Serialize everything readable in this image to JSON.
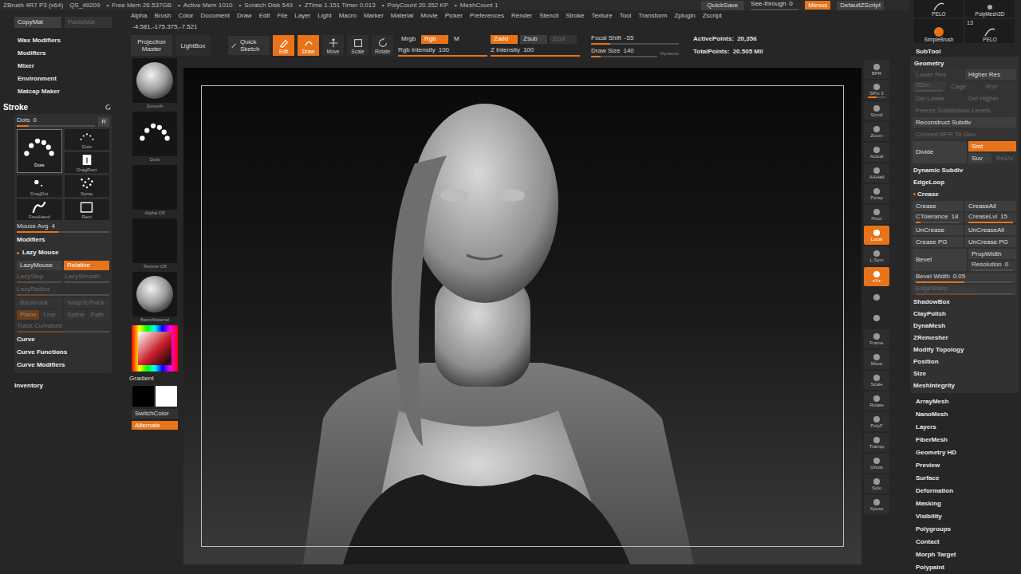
{
  "status_bar": {
    "app": "ZBrush 4R7 P3 (x64)",
    "file": "QS_49209",
    "bullet": "•",
    "stats": [
      "Free Mem 26.537GB",
      "Active Mem 1010",
      "Scratch Disk 549",
      "ZTime 1.151 Timer 0.013",
      "PolyCount 20.352 KP",
      "MeshCount 1"
    ],
    "quicksave": "QuickSave",
    "see_through": {
      "label": "See-through",
      "value": "0",
      "level": 0
    },
    "menus": {
      "label": "Menus",
      "selected": true
    },
    "script": "DefaultZScript"
  },
  "menu": [
    "Alpha",
    "Brush",
    "Color",
    "Document",
    "Draw",
    "Edit",
    "File",
    "Layer",
    "Light",
    "Macro",
    "Marker",
    "Material",
    "Movie",
    "Picker",
    "Preferences",
    "Render",
    "Stencil",
    "Stroke",
    "Texture",
    "Tool",
    "Transform",
    "Zplugin",
    "Zscript"
  ],
  "coords": "-4.581,-175.375,-7.521",
  "toolbar": {
    "large_buttons": [
      {
        "label": "Projection Master",
        "selected": false
      },
      {
        "label": "LightBox",
        "selected": false
      }
    ],
    "quick_sketch": {
      "label": "Quick Sketch",
      "selected": false
    },
    "modes": [
      {
        "label": "Edit",
        "selected": true
      },
      {
        "label": "Draw",
        "selected": true
      },
      {
        "label": "Move",
        "selected": false
      },
      {
        "label": "Scale",
        "selected": false
      },
      {
        "label": "Rotate",
        "selected": false
      }
    ],
    "color_modes": [
      {
        "label": "Mrgb",
        "selected": false,
        "disabled": false
      },
      {
        "label": "Rgb",
        "selected": true,
        "disabled": false
      },
      {
        "label": "M",
        "selected": false,
        "disabled": false
      }
    ],
    "rgb_intensity": {
      "label": "Rgb Intensity",
      "value": "100",
      "level": 1,
      "disabled": false
    },
    "z_modes": [
      {
        "label": "Zadd",
        "selected": true,
        "disabled": false
      },
      {
        "label": "Zsub",
        "selected": false,
        "disabled": false
      },
      {
        "label": "Zcut",
        "selected": false,
        "disabled": true
      }
    ],
    "z_intensity": {
      "label": "Z Intensity",
      "value": "100",
      "level": 1,
      "disabled": false
    },
    "focal_shift": {
      "label": "Focal Shift",
      "value": "-55",
      "level": 0.22,
      "disabled": false
    },
    "draw_size": {
      "label": "Draw Size",
      "value": "140",
      "level": 0.14,
      "disabled": false
    },
    "dynamic": {
      "label": "Dynamic",
      "selected": false
    },
    "stats": [
      {
        "label": "ActivePoints:",
        "value": "20,356"
      },
      {
        "label": "TotalPoints:",
        "value": "20.505 Mil"
      }
    ]
  },
  "left_tray": {
    "copy": [
      {
        "label": "CopyMat",
        "disabled": false
      },
      {
        "label": "PasteMat",
        "disabled": true
      }
    ],
    "menus": [
      "Wax Modifiers",
      "Modifiers",
      "Mixer",
      "Environment",
      "Matcap Maker"
    ],
    "stroke": {
      "title": "Stroke",
      "dots": {
        "label": "Dots",
        "value": "0",
        "level": 0.15,
        "disabled": false
      },
      "reset": "R",
      "types": [
        {
          "label": "Dots",
          "selected": true
        },
        {
          "label": "Dots",
          "selected": false
        },
        {
          "label": "DragRect",
          "selected": false
        },
        {
          "label": "DragDot",
          "selected": false
        },
        {
          "label": "Spray",
          "selected": false
        },
        {
          "label": "FreeHand",
          "selected": false
        },
        {
          "label": "Rect",
          "selected": false
        }
      ],
      "mouse_avg": {
        "label": "Mouse Avg",
        "value": "4",
        "level": 0.45,
        "disabled": false
      },
      "rows": [
        {
          "kind": "header",
          "label": "Modifiers",
          "expanded": false
        },
        {
          "kind": "header",
          "label": "Lazy Mouse",
          "expanded": true
        },
        {
          "kind": "buttons",
          "items": [
            {
              "label": "LazyMouse",
              "selected": false,
              "disabled": false
            },
            {
              "label": "Relative",
              "selected": true,
              "disabled": false
            }
          ]
        },
        {
          "kind": "sliders",
          "items": [
            {
              "label": "LazyStep",
              "level": 0.3,
              "disabled": true
            },
            {
              "label": "LazySmooth",
              "level": 0,
              "disabled": true
            }
          ]
        },
        {
          "kind": "sliders",
          "items": [
            {
              "label": "LazyRadius",
              "level": 0.3,
              "disabled": true
            }
          ]
        },
        {
          "kind": "buttons",
          "items": [
            {
              "label": "Backtrack",
              "selected": false,
              "disabled": true
            },
            {
              "label": "SnapToTrack",
              "selected": false,
              "disabled": true
            }
          ]
        },
        {
          "kind": "buttons",
          "items": [
            {
              "label": "Plane",
              "selected": true,
              "disabled": true
            },
            {
              "label": "Line",
              "selected": false,
              "disabled": true
            },
            {
              "label": "Spline",
              "selected": false,
              "disabled": true
            },
            {
              "label": "Path",
              "selected": false,
              "disabled": true
            }
          ]
        },
        {
          "kind": "sliders",
          "items": [
            {
              "label": "Track Curvature",
              "level": 0.5,
              "disabled": true
            }
          ]
        },
        {
          "kind": "header",
          "label": "Curve",
          "expanded": false
        },
        {
          "kind": "header",
          "label": "Curve Functions",
          "expanded": false
        },
        {
          "kind": "header",
          "label": "Curve Modifiers",
          "expanded": false
        }
      ]
    },
    "inventory": "Inventory"
  },
  "shelf": {
    "items": [
      {
        "label": "Smooth",
        "kind": "sphere"
      },
      {
        "label": "Dots",
        "kind": "dots"
      },
      {
        "label": "Alpha Off",
        "kind": "empty"
      },
      {
        "label": "Texture Off",
        "kind": "empty"
      },
      {
        "label": "BasicMaterial",
        "kind": "sphere"
      }
    ],
    "gradient": "Gradient",
    "switch_color": "SwitchColor",
    "alternate": {
      "label": "Alternate",
      "selected": true
    }
  },
  "right_shelf": [
    {
      "label": "BPR",
      "kind": "button",
      "selected": false
    },
    {
      "label": "SPix 3",
      "kind": "slider",
      "selected": false,
      "level": 0.5
    },
    {
      "label": "Scroll",
      "kind": "button",
      "selected": false
    },
    {
      "label": "Zoom",
      "kind": "button",
      "selected": false
    },
    {
      "label": "Actual",
      "kind": "button",
      "selected": false
    },
    {
      "label": "AAHalf",
      "kind": "button",
      "selected": false
    },
    {
      "label": "Persp",
      "kind": "button",
      "selected": false
    },
    {
      "label": "Floor",
      "kind": "button",
      "selected": false
    },
    {
      "label": "Local",
      "kind": "button",
      "selected": true
    },
    {
      "label": "L.Sym",
      "kind": "button",
      "selected": false
    },
    {
      "label": "xYz",
      "kind": "button",
      "selected": true
    },
    {
      "label": "",
      "kind": "icon",
      "selected": false
    },
    {
      "label": "",
      "kind": "icon",
      "selected": false
    },
    {
      "label": "Frame",
      "kind": "button",
      "selected": false
    },
    {
      "label": "Move",
      "kind": "button",
      "selected": false
    },
    {
      "label": "Scale",
      "kind": "button",
      "selected": false
    },
    {
      "label": "Rotate",
      "kind": "button",
      "selected": false
    },
    {
      "label": "PolyF",
      "kind": "button",
      "selected": false
    },
    {
      "label": "Transp",
      "kind": "button",
      "selected": false
    },
    {
      "label": "Ghost",
      "kind": "button",
      "selected": false
    },
    {
      "label": "Solo",
      "kind": "button",
      "selected": false
    },
    {
      "label": "Xpose",
      "kind": "button",
      "selected": false
    }
  ],
  "right_tray": {
    "tools": [
      {
        "label": "PELO",
        "kind": "hair"
      },
      {
        "label": "PolyMesh3D",
        "kind": "star"
      },
      {
        "label": "SimpleBrush",
        "kind": "brush"
      },
      {
        "label": "PELO",
        "kind": "hair"
      }
    ],
    "tool_count": "13",
    "subtool": "SubTool",
    "geometry": {
      "title": "Geometry",
      "rows": [
        {
          "kind": "row",
          "items": [
            {
              "kind": "button",
              "label": "Lower Res",
              "selected": false,
              "disabled": true
            },
            {
              "kind": "button",
              "label": "Higher Res",
              "selected": false,
              "disabled": false
            }
          ]
        },
        {
          "kind": "row",
          "items": [
            {
              "kind": "slider",
              "label": "SDiv",
              "level": 0,
              "selected": false,
              "disabled": true
            },
            {
              "kind": "button",
              "label": "Cage",
              "selected": false,
              "disabled": true
            },
            {
              "kind": "button",
              "label": "Rstr",
              "selected": false,
              "disabled": true
            }
          ]
        },
        {
          "kind": "row",
          "items": [
            {
              "kind": "button",
              "label": "Del Lower",
              "selected": false,
              "disabled": true
            },
            {
              "kind": "button",
              "label": "Del Higher",
              "selected": false,
              "disabled": true
            }
          ]
        },
        {
          "kind": "row",
          "items": [
            {
              "kind": "button",
              "label": "Freeze Subdivision Levels",
              "selected": false,
              "disabled": true
            }
          ]
        },
        {
          "kind": "row",
          "items": [
            {
              "kind": "button",
              "label": "Reconstruct Subdiv",
              "selected": false,
              "disabled": false
            }
          ]
        },
        {
          "kind": "row",
          "items": [
            {
              "kind": "button",
              "label": "Convert BPR To Geo",
              "selected": false,
              "disabled": true
            }
          ]
        },
        {
          "kind": "split",
          "main": {
            "kind": "button",
            "label": "Divide",
            "selected": false,
            "disabled": false
          },
          "side": [
            [
              {
                "kind": "button",
                "label": "Smt",
                "selected": true,
                "disabled": false
              }
            ],
            [
              {
                "kind": "button",
                "label": "Suv",
                "selected": false,
                "disabled": false
              },
              {
                "kind": "button",
                "label": "ReUV",
                "selected": false,
                "disabled": true
              }
            ]
          ]
        },
        {
          "kind": "header",
          "label": "Dynamic Subdiv",
          "expanded": false
        },
        {
          "kind": "header",
          "label": "EdgeLoop",
          "expanded": false
        },
        {
          "kind": "header",
          "label": "Crease",
          "expanded": true
        },
        {
          "kind": "row",
          "items": [
            {
              "kind": "button",
              "label": "Crease",
              "selected": false,
              "disabled": false
            },
            {
              "kind": "button",
              "label": "CreaseAll",
              "selected": false,
              "disabled": false
            }
          ]
        },
        {
          "kind": "row",
          "items": [
            {
              "kind": "slider",
              "label": "CTolerance",
              "value": "18",
              "level": 0.1,
              "selected": false,
              "disabled": false
            },
            {
              "kind": "slider",
              "label": "CreaseLvl",
              "value": "15",
              "level": 1,
              "selected": false,
              "disabled": false
            }
          ]
        },
        {
          "kind": "row",
          "items": [
            {
              "kind": "button",
              "label": "UnCrease",
              "selected": false,
              "disabled": false
            },
            {
              "kind": "button",
              "label": "UnCreaseAll",
              "selected": false,
              "disabled": false
            }
          ]
        },
        {
          "kind": "row",
          "items": [
            {
              "kind": "button",
              "label": "Crease PG",
              "selected": false,
              "disabled": false
            },
            {
              "kind": "button",
              "label": "UnCrease PG",
              "selected": false,
              "disabled": false
            }
          ]
        },
        {
          "kind": "split",
          "main": {
            "kind": "button",
            "label": "Bevel",
            "selected": false,
            "disabled": false
          },
          "side": [
            [
              {
                "kind": "button",
                "label": "PropWidth",
                "selected": false,
                "disabled": false
              }
            ],
            [
              {
                "kind": "slider",
                "label": "Resolution",
                "value": "0",
                "level": 0,
                "selected": false,
                "disabled": false
              }
            ]
          ]
        },
        {
          "kind": "row",
          "items": [
            {
              "kind": "slider",
              "label": "Bevel Width",
              "value": "0.05",
              "level": 0.5,
              "selected": false,
              "disabled": false
            }
          ]
        },
        {
          "kind": "row",
          "items": [
            {
              "kind": "slider",
              "label": "EdgeSharp",
              "level": 0.6,
              "selected": false,
              "disabled": true
            }
          ]
        },
        {
          "kind": "header",
          "label": "ShadowBox",
          "expanded": false
        },
        {
          "kind": "header",
          "label": "ClayPolish",
          "expanded": false
        },
        {
          "kind": "header",
          "label": "DynaMesh",
          "expanded": false
        },
        {
          "kind": "header",
          "label": "ZRemesher",
          "expanded": false
        },
        {
          "kind": "header",
          "label": "Modify Topology",
          "expanded": false
        },
        {
          "kind": "header",
          "label": "Position",
          "expanded": false
        },
        {
          "kind": "header",
          "label": "Size",
          "expanded": false
        },
        {
          "kind": "header",
          "label": "MeshIntegrity",
          "expanded": false
        }
      ]
    },
    "sections": [
      "ArrayMesh",
      "NanoMesh",
      "Layers",
      "FiberMesh",
      "Geometry HD",
      "Preview",
      "Surface",
      "Deformation",
      "Masking",
      "Visibility",
      "Polygroups",
      "Contact",
      "Morph Target",
      "Polypaint"
    ]
  }
}
